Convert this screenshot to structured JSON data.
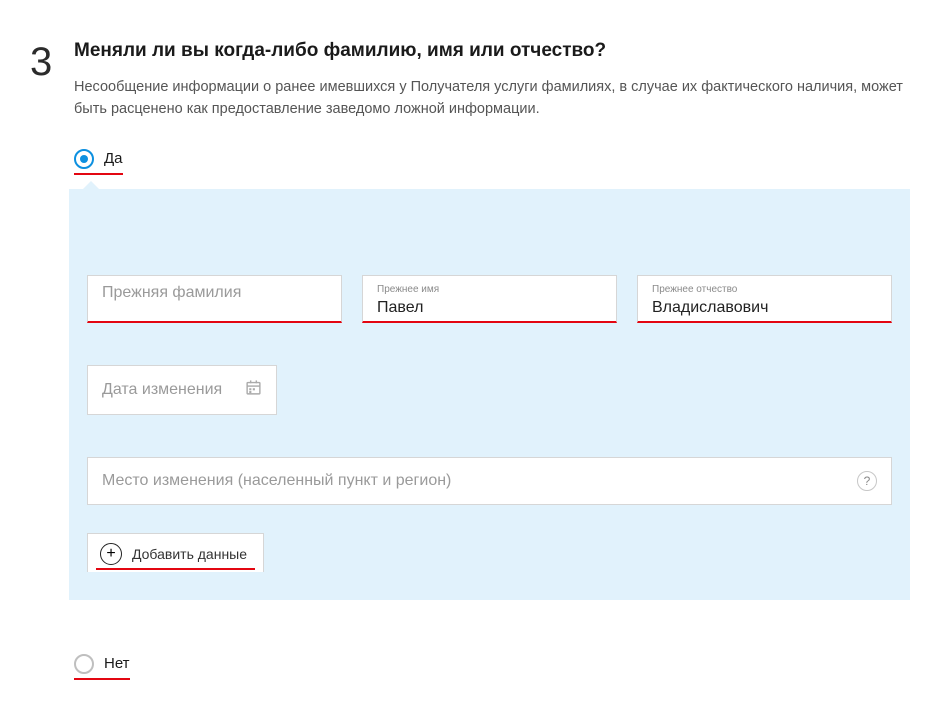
{
  "step": "3",
  "question": "Меняли ли вы когда-либо фамилию, имя или отчество?",
  "description": "Несообщение информации о ранее имевшихся у Получателя услуги фамилиях, в случае их фактического наличия, может быть расценено как предоставление заведомо ложной информации.",
  "options": {
    "yes": "Да",
    "no": "Нет"
  },
  "fields": {
    "surname": {
      "placeholder": "Прежняя фамилия",
      "value": ""
    },
    "name": {
      "label": "Прежнее имя",
      "value": "Павел"
    },
    "patronym": {
      "label": "Прежнее отчество",
      "value": "Владиславович"
    },
    "date": {
      "placeholder": "Дата изменения",
      "value": ""
    },
    "place": {
      "placeholder": "Место изменения (населенный пункт и регион)",
      "value": ""
    }
  },
  "add_button": "Добавить данные",
  "help_symbol": "?"
}
